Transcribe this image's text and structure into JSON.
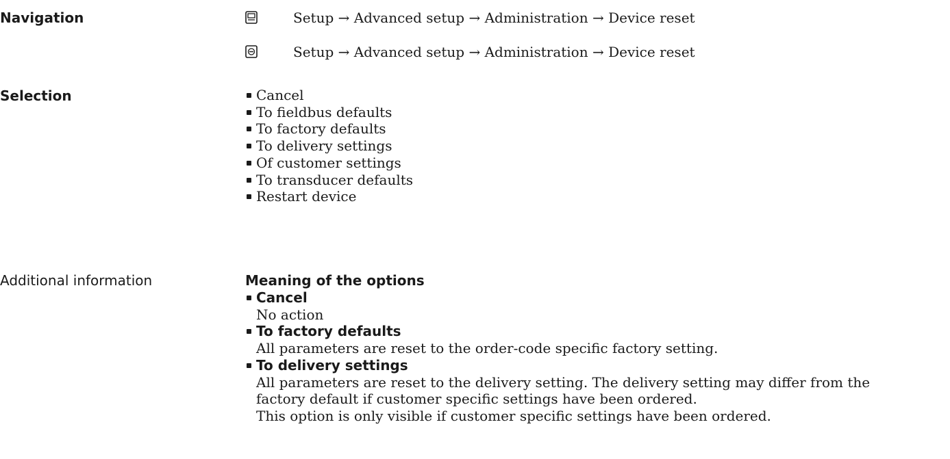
{
  "navigation": {
    "label": "Navigation",
    "paths": [
      {
        "icon": "display-module-icon",
        "text": "Setup → Advanced setup → Administration → Device reset"
      },
      {
        "icon": "operating-tool-icon",
        "text": "Setup → Advanced setup → Administration → Device reset"
      }
    ]
  },
  "selection": {
    "label": "Selection",
    "options": [
      "Cancel",
      "To fieldbus defaults",
      "To factory defaults",
      "To delivery settings",
      "Of customer settings",
      "To transducer defaults",
      "Restart device"
    ]
  },
  "additional_info": {
    "label": "Additional information",
    "heading": "Meaning of the options",
    "items": [
      {
        "title": "Cancel",
        "lines": [
          "No action"
        ]
      },
      {
        "title": "To factory defaults",
        "lines": [
          "All parameters are reset to the order-code specific factory setting."
        ]
      },
      {
        "title": "To delivery settings",
        "lines": [
          "All parameters are reset to the delivery setting. The delivery setting may differ from the",
          "factory default if customer specific settings have been ordered.",
          "This option is only visible if customer specific settings have been ordered."
        ]
      }
    ]
  }
}
